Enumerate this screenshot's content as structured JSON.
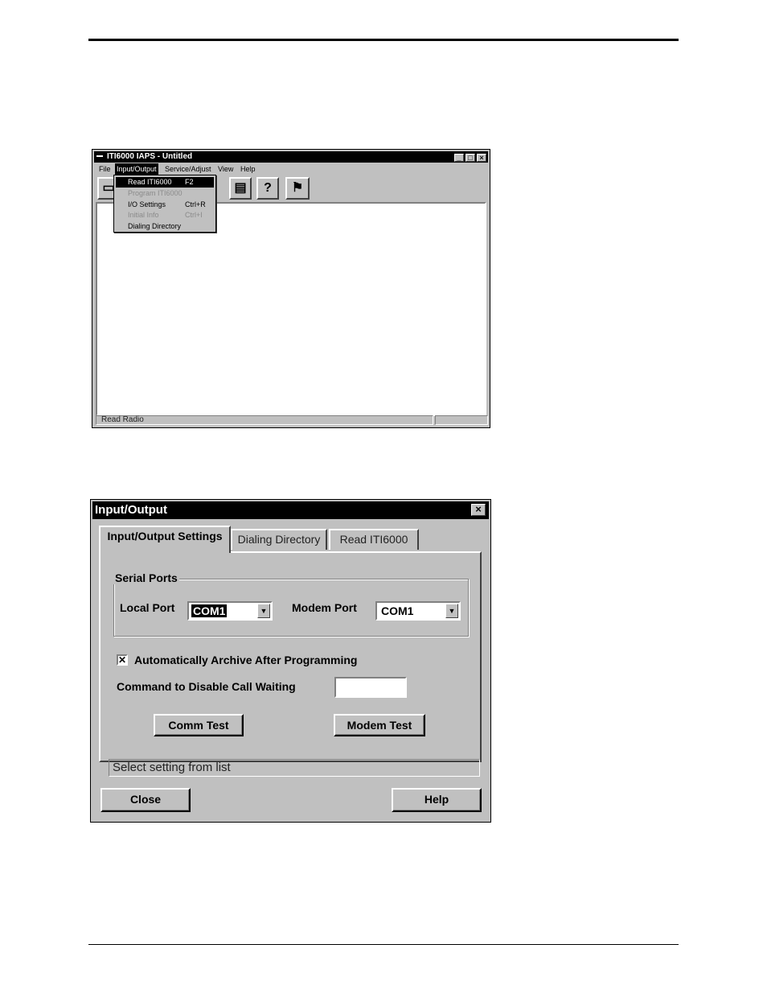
{
  "main_window": {
    "title": "ITI6000 IAPS - Untitled",
    "menus": [
      "File",
      "Input/Output",
      "Service/Adjust",
      "View",
      "Help"
    ],
    "active_menu": "Input/Output",
    "toolbar_icons": [
      "open-icon",
      "print-icon",
      "help-icon",
      "flag-icon"
    ],
    "status_text": "Read Radio",
    "dropdown": [
      {
        "label": "Read ITI6000",
        "shortcut": "F2",
        "state": "selected"
      },
      {
        "label": "Program ITI6000",
        "shortcut": "",
        "state": "disabled"
      },
      {
        "label": "I/O Settings",
        "shortcut": "Ctrl+R",
        "state": "normal"
      },
      {
        "label": "Initial Info",
        "shortcut": "Ctrl+I",
        "state": "disabled"
      },
      {
        "label": "Dialing Directory",
        "shortcut": "",
        "state": "normal"
      }
    ]
  },
  "dialog": {
    "title": "Input/Output",
    "tabs": [
      "Input/Output Settings",
      "Dialing Directory",
      "Read ITI6000"
    ],
    "active_tab": "Input/Output Settings",
    "group_label": "Serial Ports",
    "local_port_label": "Local Port",
    "local_port_value": "COM1",
    "modem_port_label": "Modem Port",
    "modem_port_value": "COM1",
    "archive_checkbox_label": "Automatically Archive After Programming",
    "archive_checked": true,
    "call_waiting_label": "Command to Disable Call Waiting",
    "call_waiting_value": "",
    "comm_test_label": "Comm Test",
    "modem_test_label": "Modem Test",
    "status_text": "Select setting from list",
    "close_label": "Close",
    "help_label": "Help"
  }
}
